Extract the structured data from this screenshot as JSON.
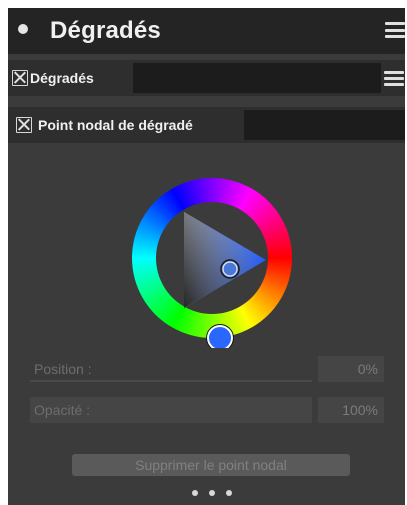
{
  "panel": {
    "title": "Dégradés"
  },
  "gradients_section": {
    "label": "Dégradés"
  },
  "node_section": {
    "label": "Point nodal de dégradé"
  },
  "color_wheel": {
    "hue_ring_colors": [
      "#ff0000",
      "#ffff00",
      "#00ff00",
      "#00ffff",
      "#0000ff",
      "#ff00ff",
      "#ff0000"
    ],
    "selected_hue_color": "#1e5bff"
  },
  "properties": {
    "position_label": "Position :",
    "position_value": "0%",
    "opacity_label": "Opacité :",
    "opacity_value": "100%"
  },
  "actions": {
    "delete_node_label": "Supprimer le point nodal"
  }
}
